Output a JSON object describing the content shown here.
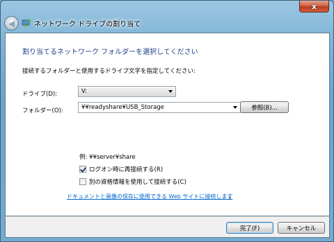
{
  "window": {
    "title": "ネットワーク ドライブの割り当て",
    "close_label": "x"
  },
  "content": {
    "heading": "割り当てるネットワーク フォルダーを選択してください",
    "instruction": "接続するフォルダーと使用するドライブ文字を指定してください:",
    "drive": {
      "label": "ドライブ(D):",
      "value": "V:"
    },
    "folder": {
      "label": "フォルダー(O):",
      "value": "¥¥readyshare¥USB_Storage"
    },
    "browse_label": "参照(B)...",
    "example": "例: ¥¥server¥share",
    "reconnect": {
      "label": "ログオン時に再接続する(R)",
      "checked": true
    },
    "other_credentials": {
      "label": "別の資格情報を使用して接続する(C)",
      "checked": false
    },
    "link_text": "ドキュメントと画像の保存に使用できる Web サイトに接続します",
    "link_suffix": "。"
  },
  "footer": {
    "finish_label": "完了(F)",
    "cancel_label": "キャンセル"
  }
}
